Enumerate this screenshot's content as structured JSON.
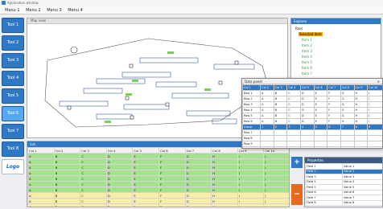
{
  "window": {
    "title": "Application window"
  },
  "menu": [
    "Menu 1",
    "Menu 2",
    "Menu 3",
    "Menu 4"
  ],
  "sidebar": [
    {
      "label": "Tool 1"
    },
    {
      "label": "Tool 2"
    },
    {
      "label": "Tool 3"
    },
    {
      "label": "Tool 4"
    },
    {
      "label": "Tool 5"
    },
    {
      "label": "Tool 6"
    },
    {
      "label": "Tool 7"
    },
    {
      "label": "Tool 8"
    },
    {
      "label": "Logo"
    }
  ],
  "map": {
    "tab_label": "Map view",
    "icon": "compass-icon",
    "pin_icon": "pin-icon"
  },
  "tree": {
    "title": "Explorer",
    "root": "Root",
    "selected": "Selected item",
    "children": [
      "Item 1",
      "Item 2",
      "Item 3",
      "Item 4",
      "Item 5",
      "Item 6",
      "Item 7"
    ]
  },
  "dialog": {
    "title": "Data panel",
    "close": "×",
    "header": [
      "Col 1",
      "Col 2",
      "Col 3",
      "Col 4",
      "Col 5",
      "Col 6",
      "Col 7",
      "Col 8",
      "Col 9",
      "Col 10"
    ],
    "rows": [
      [
        "Row 1",
        "A",
        "B",
        "C",
        "D",
        "E",
        "F",
        "G",
        "H",
        "I"
      ],
      [
        "Row 2",
        "A",
        "B",
        "C",
        "D",
        "E",
        "F",
        "G",
        "H",
        "I"
      ],
      [
        "Row 3",
        "A",
        "B",
        "C",
        "D",
        "E",
        "F",
        "G",
        "H",
        "I"
      ],
      [
        "Row 4",
        "A",
        "B",
        "C",
        "D",
        "E",
        "F",
        "G",
        "H",
        "I"
      ],
      [
        "Row 5",
        "A",
        "B",
        "C",
        "D",
        "E",
        "F",
        "G",
        "H",
        "I"
      ],
      [
        "Row 6",
        "A",
        "B",
        "C",
        "D",
        "E",
        "F",
        "G",
        "H",
        "I"
      ]
    ],
    "lower_header": [
      "Group",
      "1",
      "2",
      "3",
      "4",
      "5",
      "6",
      "7",
      "8",
      "9"
    ],
    "lower_rows": [
      [
        "Row 7",
        "",
        "",
        "",
        "",
        "",
        "",
        "",
        "",
        ""
      ],
      [
        "Row 8",
        "",
        "",
        "",
        "",
        "",
        "",
        "",
        "",
        ""
      ],
      [
        "Row 9",
        "",
        "",
        "",
        "",
        "",
        "",
        "",
        "",
        ""
      ],
      [
        "Row 10",
        "",
        "",
        "",
        "",
        "",
        "",
        "",
        "",
        ""
      ]
    ]
  },
  "grid": {
    "title": "List",
    "close": "×",
    "columns": [
      "Col 1",
      "Col 2",
      "Col 3",
      "Col 4",
      "Col 5",
      "Col 6",
      "Col 7",
      "Col 8",
      "Col 9",
      "Col 10"
    ],
    "rows": [
      {
        "c": [
          "A",
          "B",
          "C",
          "D",
          "E",
          "F",
          "G",
          "H",
          "I",
          "J"
        ],
        "color": "g"
      },
      {
        "c": [
          "A",
          "B",
          "C",
          "D",
          "E",
          "F",
          "G",
          "H",
          "I",
          "J"
        ],
        "color": "g"
      },
      {
        "c": [
          "A",
          "B",
          "C",
          "D",
          "E",
          "F",
          "G",
          "H",
          "I",
          "J"
        ],
        "color": "g"
      },
      {
        "c": [
          "A",
          "B",
          "C",
          "D",
          "E",
          "F",
          "G",
          "H",
          "I",
          "J"
        ],
        "color": "g"
      },
      {
        "c": [
          "A",
          "B",
          "C",
          "D",
          "E",
          "F",
          "G",
          "H",
          "I",
          "J"
        ],
        "color": "g"
      },
      {
        "c": [
          "A",
          "B",
          "C",
          "D",
          "E",
          "F",
          "G",
          "H",
          "I",
          "J"
        ],
        "color": "g"
      },
      {
        "c": [
          "A",
          "B",
          "C",
          "D",
          "E",
          "F",
          "G",
          "H",
          "I",
          "J"
        ],
        "color": "g"
      },
      {
        "c": [
          "A",
          "B",
          "C",
          "D",
          "E",
          "F",
          "G",
          "H",
          "I",
          "J"
        ],
        "color": "y"
      },
      {
        "c": [
          "A",
          "B",
          "C",
          "D",
          "E",
          "F",
          "G",
          "H",
          "I",
          "J"
        ],
        "color": "y"
      },
      {
        "c": [
          "A",
          "B",
          "C",
          "D",
          "E",
          "F",
          "G",
          "H",
          "I",
          "J"
        ],
        "color": "y"
      }
    ]
  },
  "props": {
    "title": "Properties",
    "plus": "+",
    "minus": "−",
    "rows": [
      [
        "Field 1",
        "Value 1"
      ],
      [
        "Field 2",
        "Value 2"
      ],
      [
        "Field 3",
        "Value 3"
      ],
      [
        "Field 4",
        "Value 4"
      ],
      [
        "Field 5",
        "Value 5"
      ],
      [
        "Field 6",
        "Value 6"
      ],
      [
        "Field 7",
        "Value 7"
      ],
      [
        "Field 8",
        "Value 8"
      ]
    ],
    "selected_index": 1
  },
  "colors": {
    "accent": "#2f78c4",
    "green_row": "#a6e28e",
    "yellow_row": "#f8eeaa",
    "tree_sel": "#f0a020",
    "minus": "#e36a1e"
  }
}
